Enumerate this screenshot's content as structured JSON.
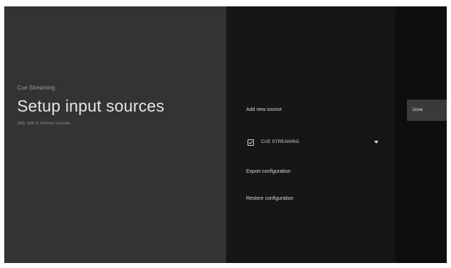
{
  "header": {
    "overline": "Cue Streaming",
    "title": "Setup input sources",
    "subtitle": "Add, edit or remove sources"
  },
  "menu": {
    "add_source": "Add new source",
    "source": {
      "label": "CUE STREAMING",
      "checked": true
    },
    "export": "Export configuration",
    "restore": "Restore configuration"
  },
  "actions": {
    "done": "Done"
  },
  "colors": {
    "left_pane": "#333333",
    "middle_pane": "#161616",
    "right_pane": "#0e0e0e",
    "button": "#3a3a3a"
  }
}
